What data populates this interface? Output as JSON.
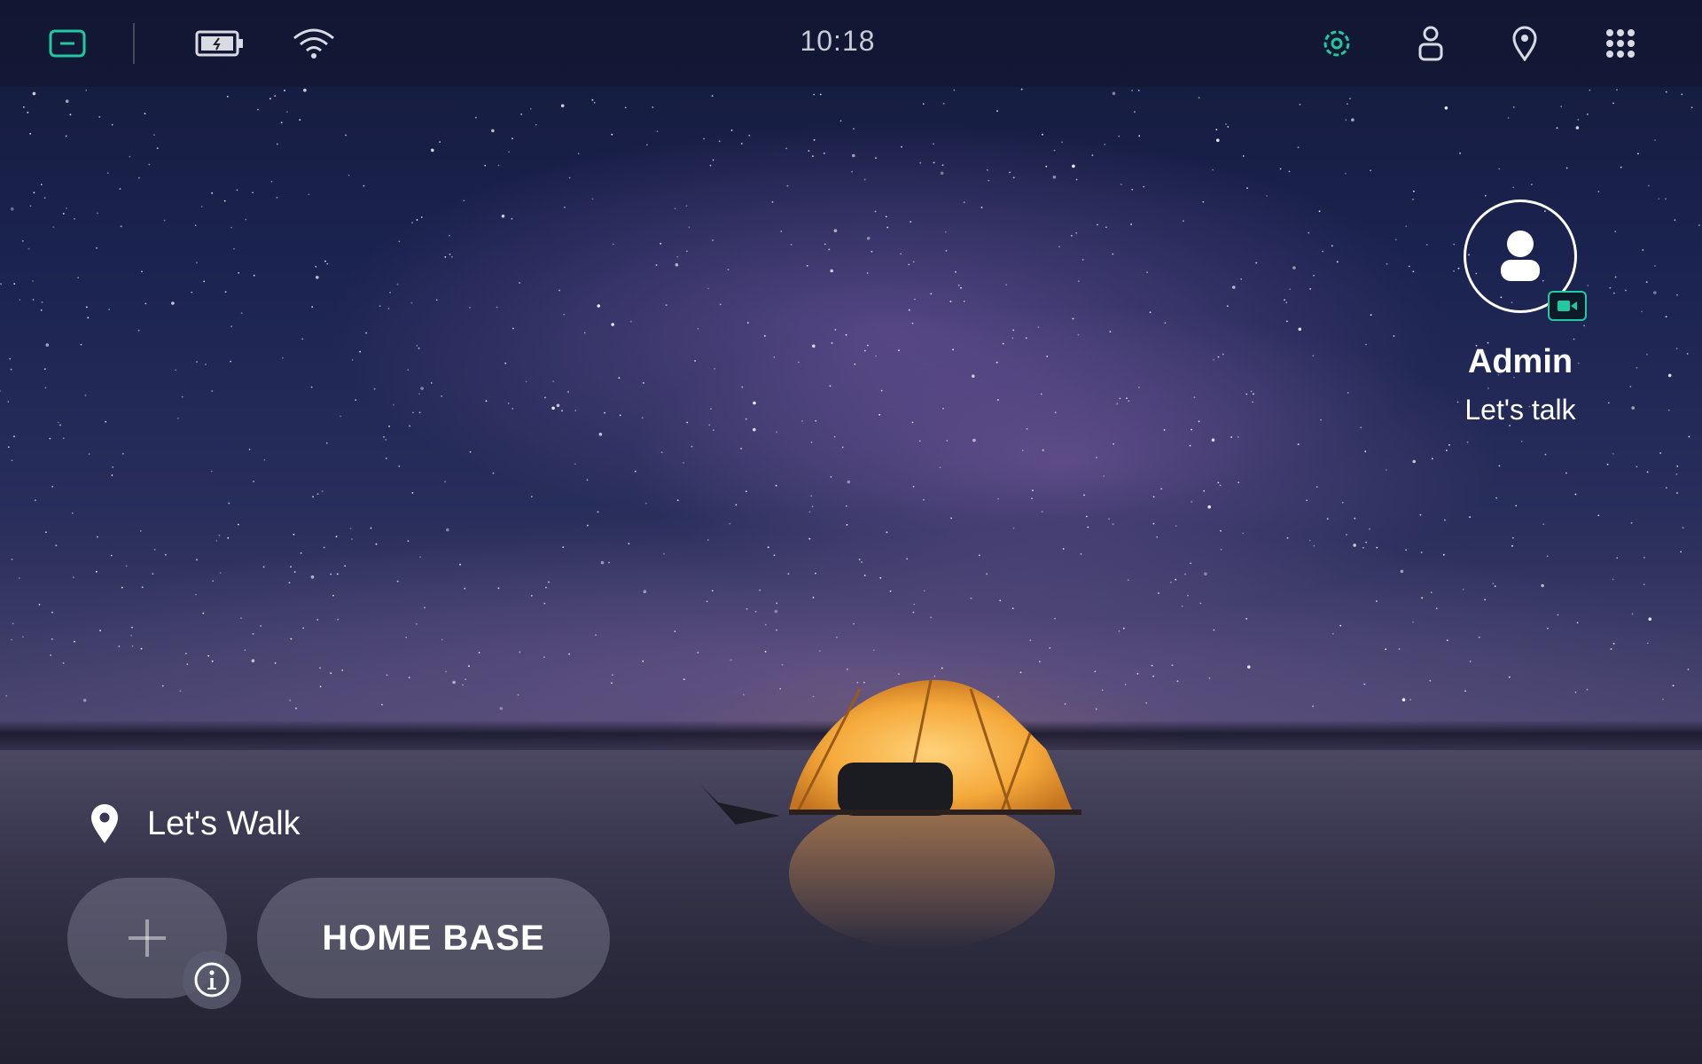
{
  "status_bar": {
    "time": "10:18",
    "icons": [
      "tablet-icon",
      "battery-icon",
      "wifi-icon",
      "settings-icon",
      "user-icon",
      "location-pin-icon",
      "apps-grid-icon"
    ],
    "accent_color": "#1fc9a1"
  },
  "contact": {
    "name": "Admin",
    "subtitle": "Let's talk",
    "badge_icon": "video-camera-icon"
  },
  "location": {
    "label": "Let's Walk",
    "icon": "location-pin-icon"
  },
  "actions": {
    "add_icon": "plus-icon",
    "info_icon": "info-icon",
    "home_label": "HOME BASE"
  }
}
